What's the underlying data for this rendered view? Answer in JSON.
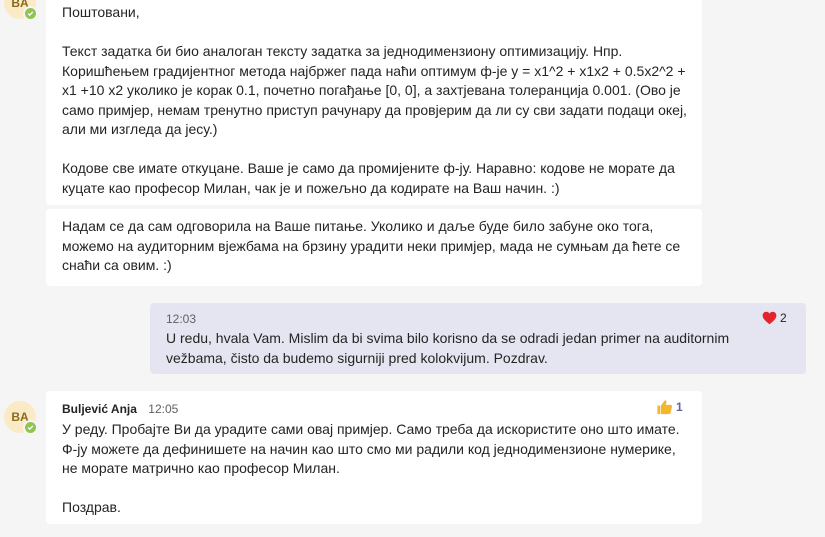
{
  "avatars": {
    "initials": "BA"
  },
  "message1": {
    "greeting": "Поштовани,",
    "paragraph1": "Текст задатка би био аналоган тексту задатка за једнодимензиону оптимизацију. Нпр. Коришћењем градијентног метода најбржег пада наћи оптимум ф-је y = x1^2 + x1x2 + 0.5x2^2 + x1 +10 x2 уколико је корак 0.1, почетно погађање [0, 0], а захтјевана толеранција 0.001. (Ово је само примјер, немам тренутно приступ рачунару да провјерим да ли су сви задати подаци океј, али ми изгледа да јесу.)",
    "paragraph2": "Кодове све имате откуцане. Ваше је само да промијените ф-ју. Наравно: кодове не морате да куцате као професор Милан, чак је и пожељно да кодирате на Ваш начин. :)"
  },
  "message2": {
    "text": "Надам се да сам одговорила на Ваше питање. Уколико и даље буде било забуне око тога, можемо на аудиторним вјежбама на брзину урадити неки примјер, мада не сумњам да ћете се снаћи са овим. :)"
  },
  "message3": {
    "time": "12:03",
    "text": "U redu, hvala Vam. Mislim da bi svima bilo korisno da se odradi jedan primer na auditornim vežbama, čisto da budemo sigurniji pred kolokvijum. Pozdrav.",
    "reaction_icon": "heart-icon",
    "reaction_color": "#e3242b",
    "reaction_count": "2"
  },
  "message4": {
    "author": "Buljević Anja",
    "time": "12:05",
    "text": "У реду. Пробајте Ви да урадите сами овај примјер. Само треба да искористите оно што имате. Ф-ју можете да дефинишете на начин као што смо ми радили код једнодимензионе нумерике, не морате матрично као професор Милан.",
    "closing": "Поздрав.",
    "reaction_icon": "thumbs-up-icon",
    "reaction_color": "#f2b630",
    "reaction_count": "1"
  },
  "colors": {
    "background": "#f5f5f5",
    "own_message": "#e5e5f1",
    "presence": "#92c353",
    "avatar_bg": "#fbeac6",
    "count_accent": "#6264a7"
  }
}
